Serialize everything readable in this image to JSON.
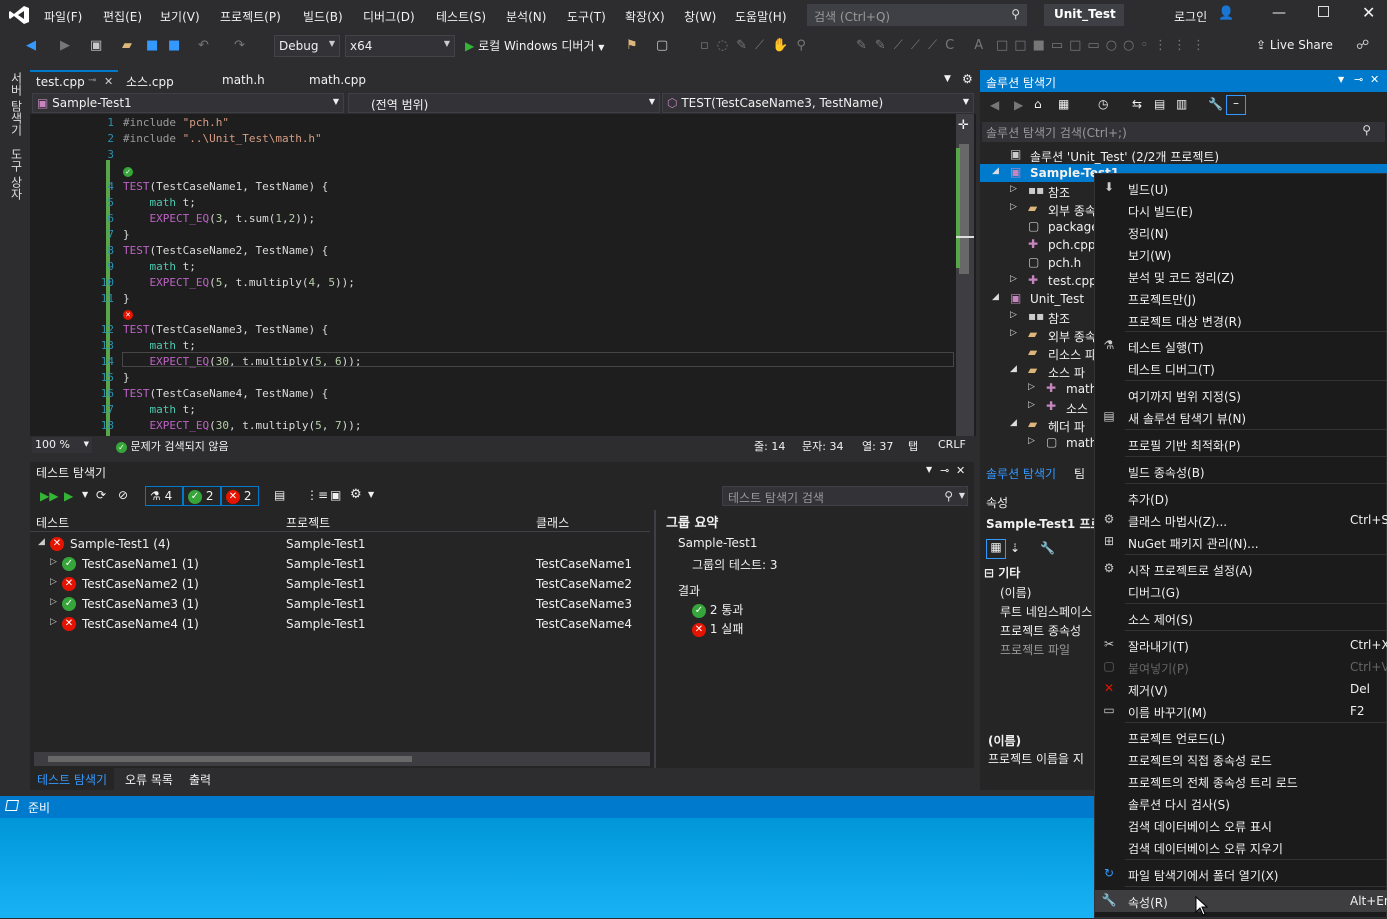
{
  "menubar": {
    "items": [
      "파일(F)",
      "편집(E)",
      "보기(V)",
      "프로젝트(P)",
      "빌드(B)",
      "디버그(D)",
      "테스트(S)",
      "분석(N)",
      "도구(T)",
      "확장(X)",
      "창(W)",
      "도움말(H)"
    ],
    "search_placeholder": "검색 (Ctrl+Q)",
    "solution_name": "Unit_Test",
    "login": "로그인"
  },
  "toolbar": {
    "config": "Debug",
    "platform": "x64",
    "debugger": "로컬 Windows 디버거",
    "live_share": "Live Share"
  },
  "leftstrip": {
    "server_explorer": "서버 탐색기",
    "toolbox": "도구 상자"
  },
  "doctabs": [
    "test.cpp",
    "소스.cpp",
    "math.h",
    "math.cpp"
  ],
  "navbar": {
    "project": "Sample-Test1",
    "scope": "(전역 범위)",
    "member": "TEST(TestCaseName3, TestName)"
  },
  "code": {
    "lines": [
      {
        "n": "1",
        "t": "#include \"pch.h\""
      },
      {
        "n": "2",
        "t": "#include \"..\\Unit_Test\\math.h\""
      },
      {
        "n": "3",
        "t": ""
      },
      {
        "n": "4",
        "t": "TEST(TestCaseName1, TestName) {"
      },
      {
        "n": "5",
        "t": "    math t;"
      },
      {
        "n": "6",
        "t": "    EXPECT_EQ(3, t.sum(1,2));"
      },
      {
        "n": "7",
        "t": "}"
      },
      {
        "n": "8",
        "t": "TEST(TestCaseName2, TestName) {"
      },
      {
        "n": "9",
        "t": "    math t;"
      },
      {
        "n": "10",
        "t": "    EXPECT_EQ(5, t.multiply(4, 5));"
      },
      {
        "n": "11",
        "t": "}"
      },
      {
        "n": "12",
        "t": "TEST(TestCaseName3, TestName) {"
      },
      {
        "n": "13",
        "t": "    math t;"
      },
      {
        "n": "14",
        "t": "    EXPECT_EQ(30, t.multiply(5, 6));"
      },
      {
        "n": "15",
        "t": "}"
      },
      {
        "n": "16",
        "t": "TEST(TestCaseName4, TestName) {"
      },
      {
        "n": "17",
        "t": "    math t;"
      },
      {
        "n": "18",
        "t": "    EXPECT_EQ(30, t.multiply(5, 7));"
      }
    ]
  },
  "editor_status": {
    "zoom": "100 %",
    "issues": "문제가 검색되지 않음",
    "line": "줄: 14",
    "char": "문자: 34",
    "col": "열: 37",
    "tab": "탭",
    "eol": "CRLF"
  },
  "test_explorer": {
    "title": "테스트 탐색기",
    "count_total": "4",
    "count_pass": "2",
    "count_fail": "2",
    "search_placeholder": "테스트 탐색기 검색",
    "headers": [
      "테스트",
      "프로젝트",
      "클래스"
    ],
    "rows": [
      {
        "name": "Sample-Test1  (4)",
        "project": "Sample-Test1",
        "class": "",
        "status": "fail"
      },
      {
        "name": "TestCaseName1  (1)",
        "project": "Sample-Test1",
        "class": "TestCaseName1",
        "status": "pass"
      },
      {
        "name": "TestCaseName2  (1)",
        "project": "Sample-Test1",
        "class": "TestCaseName2",
        "status": "fail"
      },
      {
        "name": "TestCaseName3  (1)",
        "project": "Sample-Test1",
        "class": "TestCaseName3",
        "status": "pass"
      },
      {
        "name": "TestCaseName4  (1)",
        "project": "Sample-Test1",
        "class": "TestCaseName4",
        "status": "fail"
      }
    ],
    "summary_title": "그룹 요약",
    "summary_project": "Sample-Test1",
    "summary_tests": "그룹의 테스트:  3",
    "result_label": "결과",
    "result_pass": "2  통과",
    "result_fail": "1  실패",
    "bottom_tabs": [
      "테스트 탐색기",
      "오류 목록",
      "출력"
    ]
  },
  "statusbar": {
    "text": "준비"
  },
  "solution_explorer": {
    "title": "솔루션 탐색기",
    "search_placeholder": "솔루션 탐색기 검색(Ctrl+;)",
    "tree": [
      {
        "label": "솔루션 'Unit_Test' (2/2개 프로젝트)"
      },
      {
        "label": "Sample-Test1"
      },
      {
        "label": "참조"
      },
      {
        "label": "외부 종속"
      },
      {
        "label": "package"
      },
      {
        "label": "pch.cpp"
      },
      {
        "label": "pch.h"
      },
      {
        "label": "test.cpp"
      },
      {
        "label": "Unit_Test"
      },
      {
        "label": "참조"
      },
      {
        "label": "외부 종속"
      },
      {
        "label": "리소스 파"
      },
      {
        "label": "소스 파"
      },
      {
        "label": "math"
      },
      {
        "label": "소스"
      },
      {
        "label": "헤더 파"
      },
      {
        "label": "math"
      }
    ],
    "bottom_tabs": [
      "솔루션 탐색기",
      "팀"
    ],
    "props_title": "속성",
    "props_object": "Sample-Test1 프로",
    "props_group": "기타",
    "props_rows": [
      "(이름)",
      "루트 네임스페이스",
      "프로젝트 종속성",
      "프로젝트 파일"
    ],
    "desc_title": "(이름)",
    "desc_text": "프로젝트 이름을 지"
  },
  "context_menu": {
    "items": [
      {
        "label": "빌드(U)",
        "shortcut": "",
        "icon": "build-icon"
      },
      {
        "label": "다시 빌드(E)",
        "shortcut": ""
      },
      {
        "label": "정리(N)",
        "shortcut": ""
      },
      {
        "label": "보기(W)",
        "shortcut": ""
      },
      {
        "label": "분석 및 코드 정리(Z)",
        "shortcut": ""
      },
      {
        "label": "프로젝트만(J)",
        "shortcut": ""
      },
      {
        "label": "프로젝트 대상 변경(R)",
        "shortcut": ""
      },
      {
        "label": "테스트 실행(T)",
        "shortcut": "",
        "icon": "test-run-icon"
      },
      {
        "label": "테스트 디버그(T)",
        "shortcut": ""
      },
      {
        "label": "여기까지 범위 지정(S)",
        "shortcut": ""
      },
      {
        "label": "새 솔루션 탐색기 뷰(N)",
        "shortcut": "",
        "icon": "new-view-icon"
      },
      {
        "label": "프로필 기반 최적화(P)",
        "shortcut": ""
      },
      {
        "label": "빌드 종속성(B)",
        "shortcut": ""
      },
      {
        "label": "추가(D)",
        "shortcut": ""
      },
      {
        "label": "클래스 마법사(Z)...",
        "shortcut": "Ctrl+Sh",
        "icon": "class-wizard-icon"
      },
      {
        "label": "NuGet 패키지 관리(N)...",
        "shortcut": "",
        "icon": "nuget-icon"
      },
      {
        "label": "시작 프로젝트로 설정(A)",
        "shortcut": "",
        "icon": "gear-icon"
      },
      {
        "label": "디버그(G)",
        "shortcut": ""
      },
      {
        "label": "소스 제어(S)",
        "shortcut": ""
      },
      {
        "label": "잘라내기(T)",
        "shortcut": "Ctrl+X",
        "icon": "cut-icon"
      },
      {
        "label": "붙여넣기(P)",
        "shortcut": "Ctrl+V",
        "icon": "paste-icon",
        "disabled": true
      },
      {
        "label": "제거(V)",
        "shortcut": "Del",
        "icon": "remove-icon"
      },
      {
        "label": "이름 바꾸기(M)",
        "shortcut": "F2",
        "icon": "rename-icon"
      },
      {
        "label": "프로젝트 언로드(L)",
        "shortcut": ""
      },
      {
        "label": "프로젝트의 직접 종속성 로드",
        "shortcut": ""
      },
      {
        "label": "프로젝트의 전체 종속성 트리 로드",
        "shortcut": ""
      },
      {
        "label": "솔루션 다시 검사(S)",
        "shortcut": ""
      },
      {
        "label": "검색 데이터베이스 오류 표시",
        "shortcut": ""
      },
      {
        "label": "검색 데이터베이스 오류 지우기",
        "shortcut": ""
      },
      {
        "label": "파일 탐색기에서 폴더 열기(X)",
        "shortcut": "",
        "icon": "open-folder-icon"
      },
      {
        "label": "속성(R)",
        "shortcut": "Alt+En",
        "icon": "wrench-icon"
      }
    ]
  },
  "colors": {
    "accent": "#007acc",
    "pass": "#36a53a",
    "fail": "#e51400",
    "bg": "#2d2d30",
    "editor": "#1e1e1e"
  }
}
